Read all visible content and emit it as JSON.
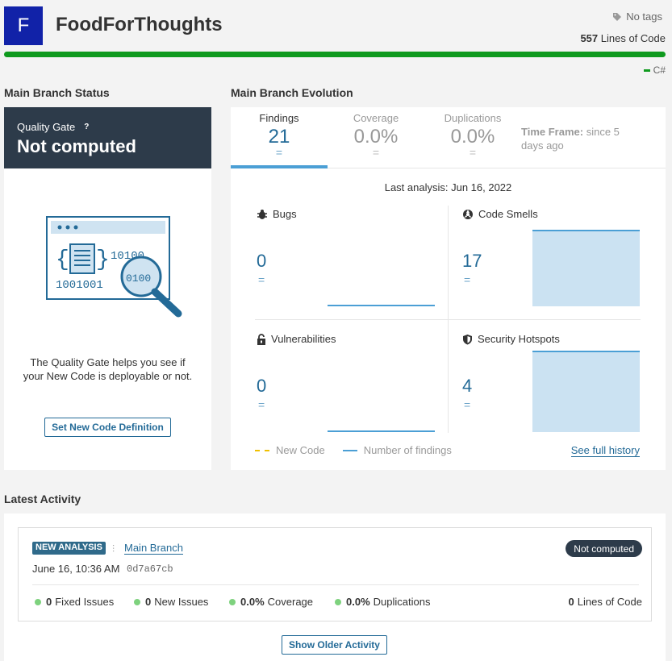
{
  "header": {
    "avatar_letter": "F",
    "project_name": "FoodForThoughts",
    "tags": "No tags",
    "loc_value": "557",
    "loc_label": "Lines of Code",
    "language": "C#",
    "language_color": "#0f9a1e"
  },
  "sections": {
    "branch_status": "Main Branch Status",
    "branch_evolution": "Main Branch Evolution",
    "latest_activity": "Latest Activity"
  },
  "quality_gate": {
    "label": "Quality Gate",
    "help": "?",
    "status": "Not computed",
    "description": "The Quality Gate helps you see if your New Code is deployable or not.",
    "button": "Set New Code Definition",
    "illustration_icon": "code-magnifier-illustration"
  },
  "evolution": {
    "tabs": [
      {
        "label": "Findings",
        "value": "21",
        "delta": "=",
        "active": true
      },
      {
        "label": "Coverage",
        "value": "0.0%",
        "delta": "=",
        "active": false
      },
      {
        "label": "Duplications",
        "value": "0.0%",
        "delta": "=",
        "active": false
      }
    ],
    "timeframe_label": "Time Frame:",
    "timeframe_value": "since 5 days ago",
    "last_analysis": "Last analysis: Jun 16, 2022",
    "metrics": {
      "bugs": {
        "label": "Bugs",
        "value": "0",
        "delta": "=",
        "icon": "bug-icon"
      },
      "code_smells": {
        "label": "Code Smells",
        "value": "17",
        "delta": "=",
        "icon": "code-smell-icon"
      },
      "vulnerabilities": {
        "label": "Vulnerabilities",
        "value": "0",
        "delta": "=",
        "icon": "lock-icon"
      },
      "security_hotspots": {
        "label": "Security Hotspots",
        "value": "4",
        "delta": "=",
        "icon": "shield-icon"
      }
    },
    "legend_new_code": "New Code",
    "legend_findings": "Number of findings",
    "full_history": "See full history",
    "accent_color": "#4b9fd5"
  },
  "activity": {
    "badge": "NEW ANALYSIS",
    "branch": "Main Branch",
    "date": "June 16, 10:36 AM",
    "hash": "0d7a67cb",
    "status": "Not computed",
    "stats": {
      "fixed_value": "0",
      "fixed_label": "Fixed Issues",
      "new_value": "0",
      "new_label": "New Issues",
      "coverage_value": "0.0%",
      "coverage_label": "Coverage",
      "dup_value": "0.0%",
      "dup_label": "Duplications",
      "loc_value": "0",
      "loc_label": "Lines of Code"
    },
    "older_button": "Show Older Activity"
  }
}
